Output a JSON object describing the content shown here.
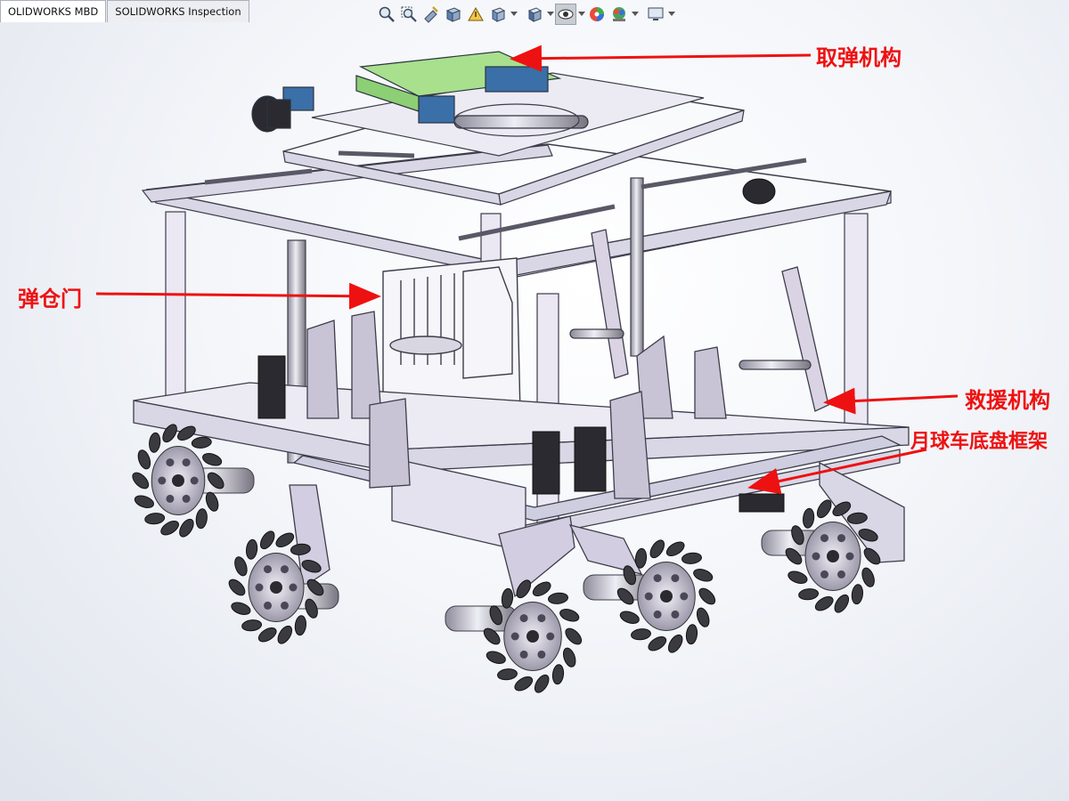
{
  "tabs": [
    {
      "label": "OLIDWORKS MBD",
      "active": true
    },
    {
      "label": "SOLIDWORKS Inspection",
      "active": false
    }
  ],
  "toolbar": {
    "icons": [
      "zoom-to-fit-icon",
      "zoom-to-area-icon",
      "previous-view-icon",
      "section-view-icon",
      "dynamic-annotation-views-icon",
      "view-orientation-icon",
      "display-style-icon",
      "hide-show-items-icon",
      "edit-appearance-icon",
      "apply-scene-icon",
      "view-settings-icon"
    ]
  },
  "annotations": [
    {
      "id": "ammo-pickup",
      "text": "取弹机构"
    },
    {
      "id": "magazine-door",
      "text": "弹仓门"
    },
    {
      "id": "rescue-mechanism",
      "text": "救援机构"
    },
    {
      "id": "chassis-frame",
      "text": "月球车底盘框架"
    }
  ],
  "colors": {
    "frame": "#d9d7e6",
    "frame_edge": "#3d3d4a",
    "green_plate": "#a8e08e",
    "blue_part": "#3a6fa8",
    "dark_part": "#2a2a30",
    "callout": "#ee1111",
    "wheel_dark": "#3a3a40",
    "wheel_hub": "#cfcbd8"
  }
}
